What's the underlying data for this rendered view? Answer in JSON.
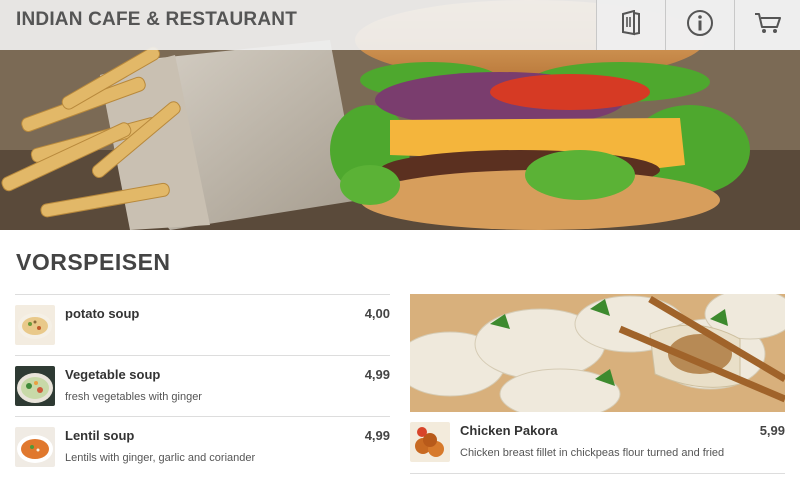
{
  "header": {
    "title": "INDIAN CAFE & RESTAURANT",
    "buttons": [
      {
        "icon": "menu-card-icon"
      },
      {
        "icon": "info-icon"
      },
      {
        "icon": "cart-icon"
      }
    ]
  },
  "hero": {
    "image": "burger-and-fries-photo"
  },
  "section": {
    "title": "VORSPEISEN"
  },
  "items": [
    {
      "name": "potato soup",
      "description": "",
      "price": "4,00"
    },
    {
      "name": "Vegetable soup",
      "description": "fresh vegetables with ginger",
      "price": "4,99"
    },
    {
      "name": "Lentil soup",
      "description": "Lentils with ginger, garlic and coriander",
      "price": "4,99"
    }
  ],
  "featured": {
    "image": "dumplings-photo",
    "name": "Chicken Pakora",
    "description": "Chicken breast fillet in chickpeas flour turned and fried",
    "price": "5,99"
  }
}
